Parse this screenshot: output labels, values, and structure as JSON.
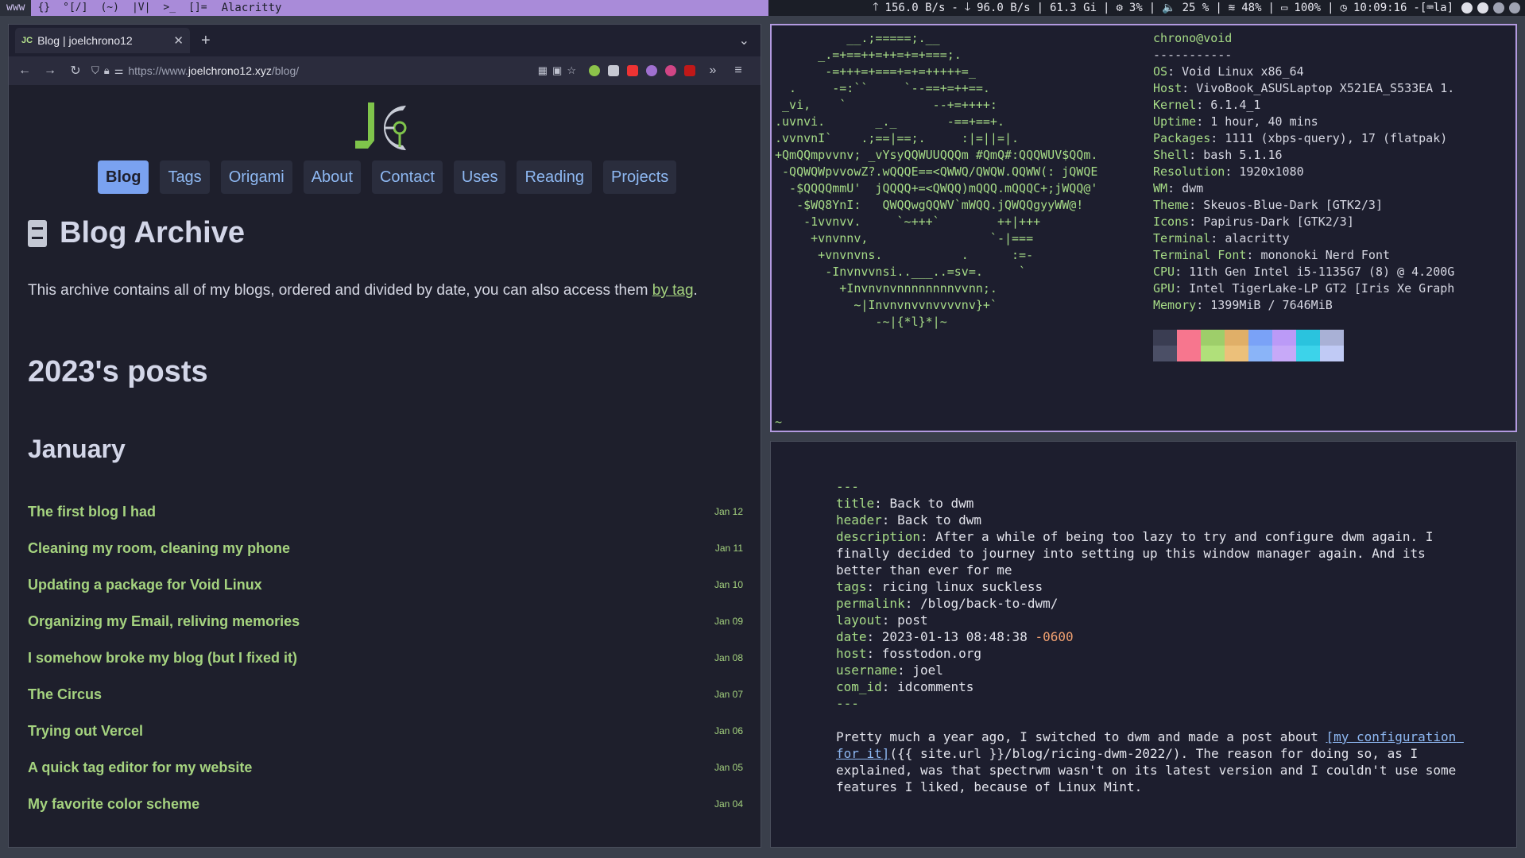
{
  "topbar": {
    "tags": [
      "www",
      "{}",
      "°[/]",
      "(~)",
      "|V|",
      ">_",
      "[]="
    ],
    "layout": "",
    "window_title": "Alacritty",
    "status": [
      "156.0 B/s",
      "96.0 B/s",
      "61.3 Gi",
      "3%",
      "25 %",
      "48%",
      "100%",
      "10:09:16"
    ],
    "keyboard": "-[⌨la]"
  },
  "browser": {
    "tab_title": "Blog | joelchrono12",
    "favicon": "JC",
    "url_prefix": "https://www.",
    "url_domain": "joelchrono12.xyz",
    "url_path": "/blog/",
    "nav": [
      "Blog",
      "Tags",
      "Origami",
      "About",
      "Contact",
      "Uses",
      "Reading",
      "Projects"
    ],
    "active_nav": "Blog",
    "archive_title": "Blog Archive",
    "archive_desc": "This archive contains all of my blogs, ordered and divided by date, you can also access them ",
    "archive_link": "by tag",
    "year_heading": "2023's posts",
    "month_heading": "January",
    "posts": [
      {
        "title": "The first blog I had",
        "date": "Jan 12"
      },
      {
        "title": "Cleaning my room, cleaning my phone",
        "date": "Jan 11"
      },
      {
        "title": "Updating a package for Void Linux",
        "date": "Jan 10"
      },
      {
        "title": "Organizing my Email, reliving memories",
        "date": "Jan 09"
      },
      {
        "title": "I somehow broke my blog (but I fixed it)",
        "date": "Jan 08"
      },
      {
        "title": "The Circus",
        "date": "Jan 07"
      },
      {
        "title": "Trying out Vercel",
        "date": "Jan 06"
      },
      {
        "title": "A quick tag editor for my website",
        "date": "Jan 05"
      },
      {
        "title": "My favorite color scheme",
        "date": "Jan 04"
      }
    ]
  },
  "fetch": {
    "user_host": "chrono@void",
    "separator": "-----------",
    "lines": [
      {
        "k": "OS",
        "v": "Void Linux x86_64"
      },
      {
        "k": "Host",
        "v": "VivoBook_ASUSLaptop X521EA_S533EA 1."
      },
      {
        "k": "Kernel",
        "v": "6.1.4_1"
      },
      {
        "k": "Uptime",
        "v": "1 hour, 40 mins"
      },
      {
        "k": "Packages",
        "v": "1111 (xbps-query), 17 (flatpak)"
      },
      {
        "k": "Shell",
        "v": "bash 5.1.16"
      },
      {
        "k": "Resolution",
        "v": "1920x1080"
      },
      {
        "k": "WM",
        "v": "dwm"
      },
      {
        "k": "Theme",
        "v": "Skeuos-Blue-Dark [GTK2/3]"
      },
      {
        "k": "Icons",
        "v": "Papirus-Dark [GTK2/3]"
      },
      {
        "k": "Terminal",
        "v": "alacritty"
      },
      {
        "k": "Terminal Font",
        "v": "mononoki Nerd Font"
      },
      {
        "k": "CPU",
        "v": "11th Gen Intel i5-1135G7 (8) @ 4.200G"
      },
      {
        "k": "GPU",
        "v": "Intel TigerLake-LP GT2 [Iris Xe Graph"
      },
      {
        "k": "Memory",
        "v": "1399MiB / 7646MiB"
      }
    ],
    "ascii": "          __.;=====;.__\n      _.=+==++=++=+=+===;.\n       -=+++=+===+=+=+++++=_\n  .     -=:``     `--==+=++==.\n _vi,    `            --+=++++:\n.uvnvi.       _._       -==+==+.\n.vvnvnI`    .;==|==;.     :|=||=|.\n+QmQQmpvvnv; _vYsyQQWUUQQQm #QmQ#:QQQWUV$QQm.\n -QQWQWpvvowZ?.wQQQE==<QWWQ/QWQW.QQWW(: jQWQE\n  -$QQQQmmU'  jQQQQ+=<QWQQ)mQQQ.mQQQC+;jWQQ@'\n   -$WQ8YnI:   QWQQwgQQWV`mWQQ.jQWQQgyyWW@!\n    -1vvnvv.     `~+++`        ++|+++\n     +vnvnnv,                 `-|===\n      +vnvnvns.           .      :=-\n       -Invnvvnsi..___..=sv=.     `\n         +Invnvnvnnnnnnnnvvnn;.\n           ~|Invnvnvvnvvvvnv}+`\n              -~|{*l}*|~",
    "swatches": [
      "#3a3d52",
      "#f7768e",
      "#9ece6a",
      "#e0af68",
      "#7aa2f7",
      "#bb9af7",
      "#2ac3de",
      "#a9b1d6"
    ],
    "swatch_bottom": [
      "#4b4f66",
      "#f7768e",
      "#b0e07a",
      "#ecc07a",
      "#8ab4f8",
      "#c7a9f8",
      "#3cd3ea",
      "#c0caf5"
    ],
    "prompt": "~"
  },
  "editor": {
    "fm": [
      {
        "k": "title",
        "v": "Back to dwm"
      },
      {
        "k": "header",
        "v": "Back to dwm"
      },
      {
        "k": "description",
        "v": "After a while of being too lazy to try and configure dwm again. I finally decided to journey into setting up this window manager again. And its better than ever for me"
      },
      {
        "k": "tags",
        "v": "ricing linux suckless"
      },
      {
        "k": "permalink",
        "v": "/blog/back-to-dwm/"
      },
      {
        "k": "layout",
        "v": "post"
      },
      {
        "k": "date",
        "v": "2023-01-13 08:48:38",
        "tz": "-0600"
      },
      {
        "k": "host",
        "v": "fosstodon.org"
      },
      {
        "k": "username",
        "v": "joel"
      },
      {
        "k": "com_id",
        "v": "idcomments"
      }
    ],
    "dashes": "---",
    "body_pre": "Pretty much a year ago, I switched to dwm and made a post about ",
    "body_link": "[my configuration for it]",
    "body_post": "({{ site.url }}/blog/ricing-dwm-2022/). The reason for doing so, as I explained, was that spectrwm wasn't on its latest version and I couldn't use some features I liked, because of Linux Mint."
  }
}
